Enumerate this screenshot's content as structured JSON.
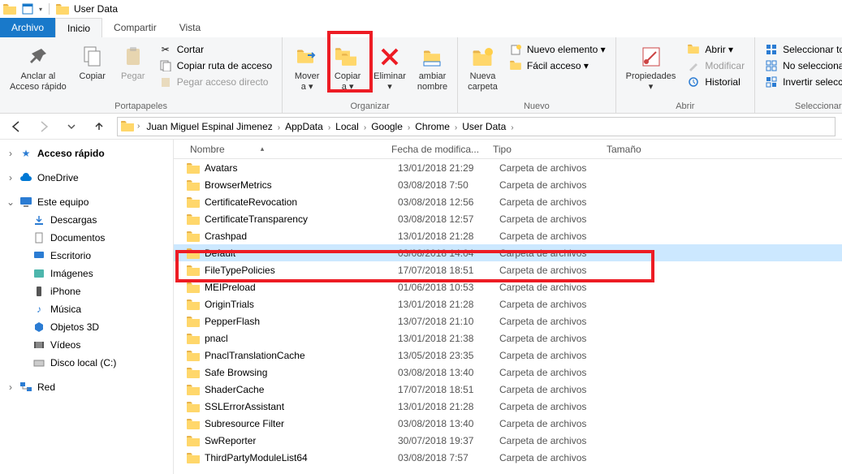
{
  "window": {
    "title": "User Data"
  },
  "tabs": {
    "archivo": "Archivo",
    "inicio": "Inicio",
    "compartir": "Compartir",
    "vista": "Vista"
  },
  "ribbon": {
    "portapapeles": {
      "label": "Portapapeles",
      "anclar": "Anclar al\nAcceso rápido",
      "copiar": "Copiar",
      "pegar": "Pegar",
      "cortar": "Cortar",
      "copiar_ruta": "Copiar ruta de acceso",
      "pegar_acceso": "Pegar acceso directo"
    },
    "organizar": {
      "label": "Organizar",
      "mover": "Mover\na ▾",
      "copiar": "Copiar\na ▾",
      "eliminar": "Eliminar\n▾",
      "cambiar": "ambiar\nnombre"
    },
    "nuevo": {
      "label": "Nuevo",
      "carpeta": "Nueva\ncarpeta",
      "nuevo_el": "Nuevo elemento ▾",
      "facil": "Fácil acceso ▾"
    },
    "abrir": {
      "label": "Abrir",
      "propiedades": "Propiedades\n▾",
      "abrir": "Abrir ▾",
      "modificar": "Modificar",
      "historial": "Historial"
    },
    "seleccionar": {
      "label": "Seleccionar",
      "todo": "Seleccionar todo",
      "nada": "No seleccionar nada",
      "invertir": "Invertir selección"
    }
  },
  "breadcrumb": [
    "Juan Miguel Espinal Jimenez",
    "AppData",
    "Local",
    "Google",
    "Chrome",
    "User Data"
  ],
  "columns": {
    "name": "Nombre",
    "date": "Fecha de modifica...",
    "type": "Tipo",
    "size": "Tamaño"
  },
  "nav": {
    "acceso_rapido": "Acceso rápido",
    "onedrive": "OneDrive",
    "este_equipo": "Este equipo",
    "descargas": "Descargas",
    "documentos": "Documentos",
    "escritorio": "Escritorio",
    "imagenes": "Imágenes",
    "iphone": "iPhone",
    "musica": "Música",
    "objetos3d": "Objetos 3D",
    "videos": "Vídeos",
    "disco_c": "Disco local (C:)",
    "red": "Red"
  },
  "rows": [
    {
      "name": "Avatars",
      "date": "13/01/2018 21:29",
      "type": "Carpeta de archivos"
    },
    {
      "name": "BrowserMetrics",
      "date": "03/08/2018 7:50",
      "type": "Carpeta de archivos"
    },
    {
      "name": "CertificateRevocation",
      "date": "03/08/2018 12:56",
      "type": "Carpeta de archivos"
    },
    {
      "name": "CertificateTransparency",
      "date": "03/08/2018 12:57",
      "type": "Carpeta de archivos"
    },
    {
      "name": "Crashpad",
      "date": "13/01/2018 21:28",
      "type": "Carpeta de archivos"
    },
    {
      "name": "Default",
      "date": "03/08/2018 14:04",
      "type": "Carpeta de archivos",
      "selected": true
    },
    {
      "name": "FileTypePolicies",
      "date": "17/07/2018 18:51",
      "type": "Carpeta de archivos"
    },
    {
      "name": "MEIPreload",
      "date": "01/06/2018 10:53",
      "type": "Carpeta de archivos"
    },
    {
      "name": "OriginTrials",
      "date": "13/01/2018 21:28",
      "type": "Carpeta de archivos"
    },
    {
      "name": "PepperFlash",
      "date": "13/07/2018 21:10",
      "type": "Carpeta de archivos"
    },
    {
      "name": "pnacl",
      "date": "13/01/2018 21:38",
      "type": "Carpeta de archivos"
    },
    {
      "name": "PnaclTranslationCache",
      "date": "13/05/2018 23:35",
      "type": "Carpeta de archivos"
    },
    {
      "name": "Safe Browsing",
      "date": "03/08/2018 13:40",
      "type": "Carpeta de archivos"
    },
    {
      "name": "ShaderCache",
      "date": "17/07/2018 18:51",
      "type": "Carpeta de archivos"
    },
    {
      "name": "SSLErrorAssistant",
      "date": "13/01/2018 21:28",
      "type": "Carpeta de archivos"
    },
    {
      "name": "Subresource Filter",
      "date": "03/08/2018 13:40",
      "type": "Carpeta de archivos"
    },
    {
      "name": "SwReporter",
      "date": "30/07/2018 19:37",
      "type": "Carpeta de archivos"
    },
    {
      "name": "ThirdPartyModuleList64",
      "date": "03/08/2018 7:57",
      "type": "Carpeta de archivos"
    }
  ]
}
